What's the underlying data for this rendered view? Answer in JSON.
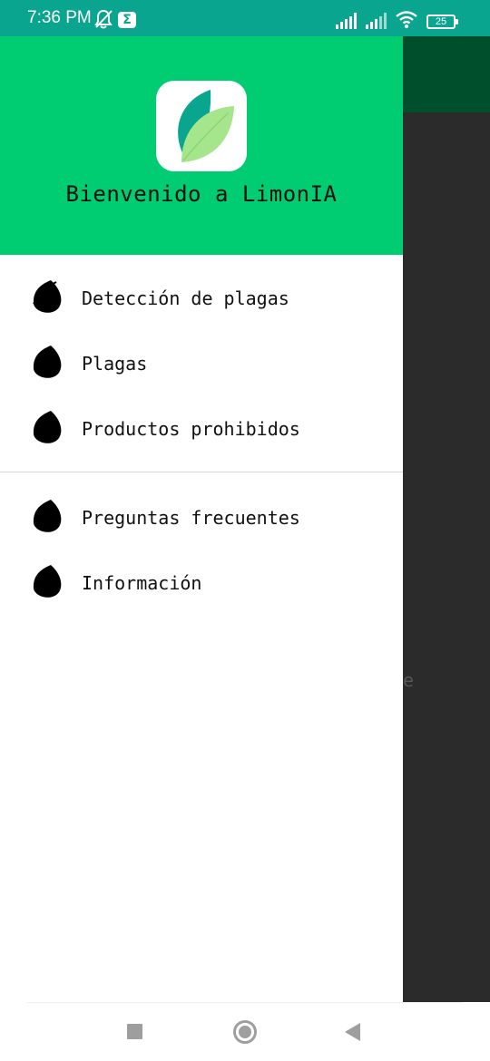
{
  "status_bar": {
    "time": "7:36 PM",
    "sigma": "Σ",
    "battery": "25",
    "icons": [
      "bell-off-icon",
      "sigma-icon",
      "signal-icon",
      "signal-icon",
      "wifi-icon",
      "battery-icon"
    ]
  },
  "background": {
    "partial_text": "e"
  },
  "drawer": {
    "header": {
      "title": "Bienvenido a LimonIA",
      "logo_icon": "leaf-logo-icon"
    },
    "menu_primary": [
      {
        "label": "Detección de plagas",
        "icon": "leaf-icon"
      },
      {
        "label": "Plagas",
        "icon": "leaf-icon"
      },
      {
        "label": "Productos prohibidos",
        "icon": "leaf-icon"
      }
    ],
    "menu_secondary": [
      {
        "label": "Preguntas frecuentes",
        "icon": "leaf-icon"
      },
      {
        "label": "Información",
        "icon": "leaf-icon"
      }
    ]
  },
  "nav_bar": {
    "icons": [
      "recents-icon",
      "home-icon",
      "back-icon"
    ]
  },
  "colors": {
    "status_bar": "#0aa58f",
    "drawer_header": "#00cc72",
    "app_bar": "#004f2c",
    "scrim": "#2b2b2b",
    "logo_leaf_dark": "#0aa58f",
    "logo_leaf_light": "#a5e58b"
  }
}
